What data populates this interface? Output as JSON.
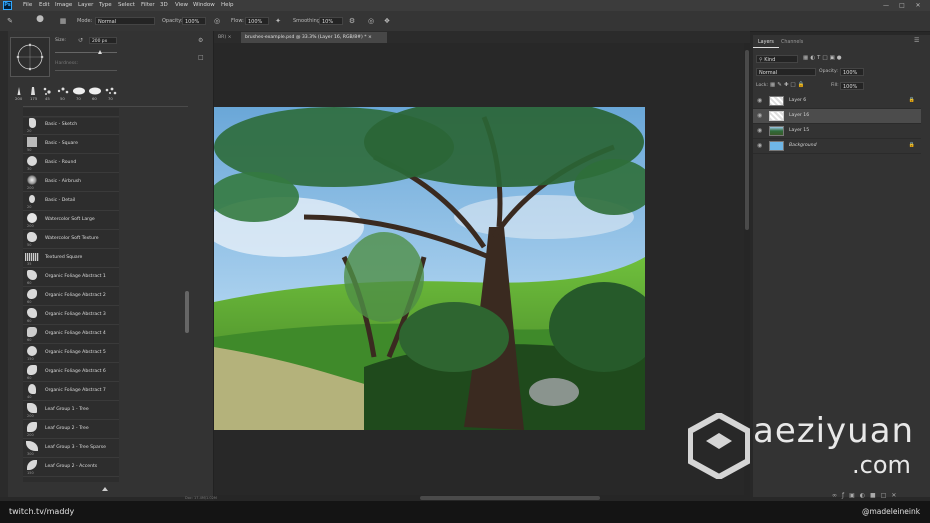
{
  "app_icon": "Ps",
  "menu": [
    "File",
    "Edit",
    "Image",
    "Layer",
    "Type",
    "Select",
    "Filter",
    "3D",
    "View",
    "Window",
    "Help"
  ],
  "options": {
    "mode_label": "Mode:",
    "mode_value": "Normal",
    "opacity_label": "Opacity:",
    "opacity_value": "100%",
    "flow_label": "Flow:",
    "flow_value": "100%",
    "smoothing_label": "Smoothing:",
    "smoothing_value": "10%"
  },
  "brush_panel": {
    "size_label": "Size:",
    "size_value": "200 px",
    "hardness_label": "Hardness:",
    "recent_sizes": [
      "200",
      "175",
      "45",
      "50",
      "70",
      "60",
      "70"
    ],
    "brushes": [
      {
        "name": "Basic - Sketch",
        "size": "20"
      },
      {
        "name": "Basic - Square",
        "size": "50"
      },
      {
        "name": "Basic - Round",
        "size": "30"
      },
      {
        "name": "Basic - Airbrush",
        "size": "200"
      },
      {
        "name": "Basic - Detail",
        "size": "20"
      },
      {
        "name": "Watercolor Soft Large",
        "size": "200"
      },
      {
        "name": "Watercolor Soft Texture",
        "size": "50"
      },
      {
        "name": "Textured Square",
        "size": "35"
      },
      {
        "name": "Organic Foliage Abstract 1",
        "size": "60"
      },
      {
        "name": "Organic Foliage Abstract 2",
        "size": "60"
      },
      {
        "name": "Organic Foliage Abstract 3",
        "size": "60"
      },
      {
        "name": "Organic Foliage Abstract 4",
        "size": "60"
      },
      {
        "name": "Organic Foliage Abstract 5",
        "size": "150"
      },
      {
        "name": "Organic Foliage Abstract 6",
        "size": "60"
      },
      {
        "name": "Organic Foliage Abstract 7",
        "size": "40"
      },
      {
        "name": "Leaf Group 1 - Tree",
        "size": "200"
      },
      {
        "name": "Leaf Group 2 - Tree",
        "size": "200"
      },
      {
        "name": "Leaf Group 3 - Tree Sparse",
        "size": "300"
      },
      {
        "name": "Leaf Group 2 - Accents",
        "size": "150"
      }
    ]
  },
  "tabs": {
    "inactive": "BR) ×",
    "active": "brushes-example.psd @ 33.3% (Layer 16, RGB/8#) * ×"
  },
  "status": {
    "doc_info": "Doc: 17.4M/1.02M"
  },
  "layers_panel": {
    "tabs": [
      "Layers",
      "Channels"
    ],
    "filter": "Kind",
    "blend_mode": "Normal",
    "opacity_label": "Opacity:",
    "opacity_value": "100%",
    "lock_label": "Lock:",
    "fill_label": "Fill:",
    "fill_value": "100%",
    "layers": [
      {
        "name": "Layer 6",
        "locked": true,
        "selected": false
      },
      {
        "name": "Layer 16",
        "locked": false,
        "selected": true
      },
      {
        "name": "Layer 15",
        "locked": false,
        "selected": false
      },
      {
        "name": "Background",
        "locked": true,
        "selected": false
      }
    ]
  },
  "footer": {
    "left_text": "twitch.tv/maddy",
    "right_text": "@madeleineink"
  },
  "watermark": {
    "line1": "aeziyuan",
    "line2": ".com"
  }
}
